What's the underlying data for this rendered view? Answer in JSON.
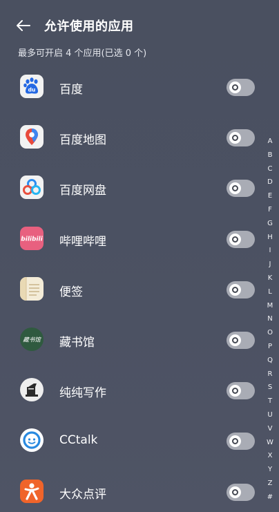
{
  "header": {
    "title": "允许使用的应用",
    "subtitle": "最多可开启 4 个应用(已选 0 个)"
  },
  "apps": [
    {
      "name": "百度",
      "icon": "baidu-icon",
      "on": false
    },
    {
      "name": "百度地图",
      "icon": "baidu-map-icon",
      "on": false
    },
    {
      "name": "百度网盘",
      "icon": "baidu-netdisk-icon",
      "on": false
    },
    {
      "name": "哔哩哔哩",
      "icon": "bilibili-icon",
      "on": false
    },
    {
      "name": "便签",
      "icon": "notes-icon",
      "on": false
    },
    {
      "name": "藏书馆",
      "icon": "cangshuguan-icon",
      "on": false
    },
    {
      "name": "纯纯写作",
      "icon": "chunchun-writing-icon",
      "on": false
    },
    {
      "name": "CCtalk",
      "icon": "cctalk-icon",
      "on": false
    },
    {
      "name": "大众点评",
      "icon": "dianping-icon",
      "on": false
    }
  ],
  "icon_text": {
    "baidu": "du",
    "bilibili": "bilibili",
    "cangshuguan": "藏书馆"
  },
  "alphabet": [
    "A",
    "B",
    "C",
    "D",
    "E",
    "F",
    "G",
    "H",
    "I",
    "J",
    "K",
    "L",
    "M",
    "N",
    "O",
    "P",
    "Q",
    "R",
    "S",
    "T",
    "U",
    "V",
    "W",
    "X",
    "Y",
    "Z",
    "#"
  ],
  "colors": {
    "background": "#4b5162",
    "toggle_off": "#a9acb5",
    "bilibili": "#e8607f",
    "cangshuguan": "#2f5a3f",
    "dianping": "#f0642a",
    "cctalk": "#2a8ae0"
  }
}
